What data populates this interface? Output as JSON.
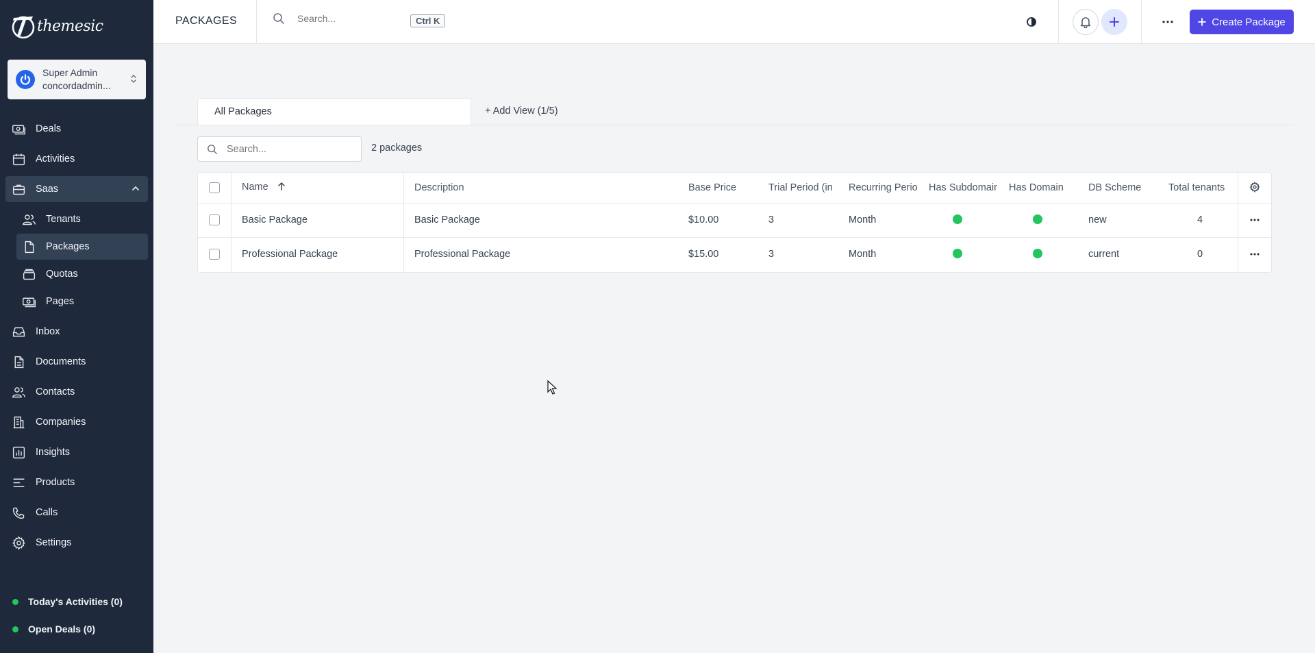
{
  "app": {
    "logo_text": "themesic"
  },
  "user": {
    "name": "Super Admin",
    "email": "concordadmin..."
  },
  "sidebar": {
    "items": [
      {
        "label": "Deals"
      },
      {
        "label": "Activities"
      },
      {
        "label": "Saas"
      },
      {
        "label": "Inbox"
      },
      {
        "label": "Documents"
      },
      {
        "label": "Contacts"
      },
      {
        "label": "Companies"
      },
      {
        "label": "Insights"
      },
      {
        "label": "Products"
      },
      {
        "label": "Calls"
      },
      {
        "label": "Settings"
      }
    ],
    "saas_children": [
      {
        "label": "Tenants"
      },
      {
        "label": "Packages"
      },
      {
        "label": "Quotas"
      },
      {
        "label": "Pages"
      }
    ],
    "footer": {
      "todays_activities": "Today's Activities (0)",
      "open_deals": "Open Deals (0)"
    }
  },
  "header": {
    "title": "PACKAGES",
    "search_placeholder": "Search...",
    "shortcut": "Ctrl K",
    "create_button": "Create Package"
  },
  "views": {
    "active_tab": "All Packages",
    "add_view": "+ Add View (1/5)"
  },
  "table": {
    "search_placeholder": "Search...",
    "count_label": "2 packages",
    "columns": {
      "name": "Name",
      "description": "Description",
      "base_price": "Base Price",
      "trial_period": "Trial Period (in",
      "recurring_period": "Recurring Perio",
      "has_subdomain": "Has Subdomain",
      "has_domain": "Has Domain",
      "db_scheme": "DB Scheme",
      "total_tenants": "Total tenants"
    },
    "sort": {
      "column": "Name",
      "direction": "ascending"
    },
    "rows": [
      {
        "name": "Basic Package",
        "description": "Basic Package",
        "base_price": "$10.00",
        "trial_period": "3",
        "recurring_period": "Month",
        "has_subdomain": true,
        "has_domain": true,
        "db_scheme": "new",
        "total_tenants": "4"
      },
      {
        "name": "Professional Package",
        "description": "Professional Package",
        "base_price": "$15.00",
        "trial_period": "3",
        "recurring_period": "Month",
        "has_subdomain": true,
        "has_domain": true,
        "db_scheme": "current",
        "total_tenants": "0"
      }
    ]
  },
  "colors": {
    "sidebar_bg": "#1e293b",
    "accent": "#4f46e5",
    "status_true": "#22c55e"
  }
}
